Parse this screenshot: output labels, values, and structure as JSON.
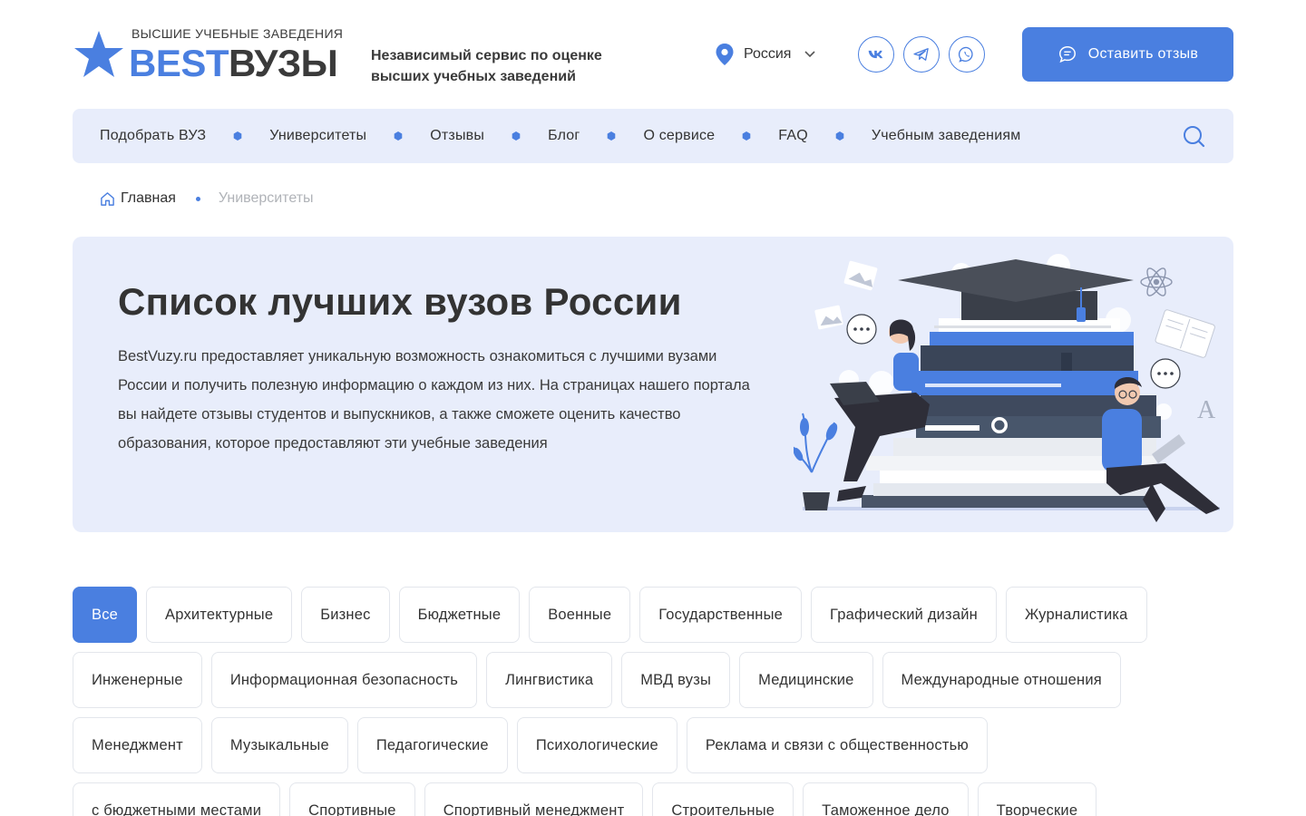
{
  "header": {
    "logo_small": "ВЫСШИЕ УЧЕБНЫЕ ЗАВЕДЕНИЯ",
    "logo_best": "BEST",
    "logo_vuzy": "ВУЗЫ",
    "tagline_line1": "Независимый сервис по оценке",
    "tagline_line2": "высших учебных заведений",
    "region": "Россия",
    "review_button": "Оставить отзыв",
    "socials": [
      "vk-icon",
      "telegram-icon",
      "whatsapp-icon"
    ]
  },
  "nav": {
    "items": [
      "Подобрать ВУЗ",
      "Университеты",
      "Отзывы",
      "Блог",
      "О сервисе",
      "FAQ",
      "Учебным заведениям"
    ]
  },
  "breadcrumb": {
    "home": "Главная",
    "current": "Университеты"
  },
  "hero": {
    "title": "Список лучших вузов России",
    "text": "BestVuzy.ru предоставляет уникальную возможность ознакомиться с лучшими вузами России и получить полезную информацию о каждом из них. На страницах нашего портала вы найдете отзывы студентов и выпускников, а также сможете оценить качество образования, которое предоставляют эти учебные заведения"
  },
  "filters": {
    "active": "Все",
    "rows": [
      [
        "Все",
        "Архитектурные",
        "Бизнес",
        "Бюджетные",
        "Военные",
        "Государственные",
        "Графический дизайн",
        "Журналистика"
      ],
      [
        "Инженерные",
        "Информационная безопасность",
        "Лингвистика",
        "МВД вузы",
        "Медицинские",
        "Международные отношения"
      ],
      [
        "Менеджмент",
        "Музыкальные",
        "Педагогические",
        "Психологические",
        "Реклама и связи с общественностью"
      ],
      [
        "с бюджетными местами",
        "Спортивные",
        "Спортивный менеджмент",
        "Строительные",
        "Таможенное дело",
        "Творческие"
      ]
    ]
  },
  "colors": {
    "accent": "#4a7fe0",
    "light_bg": "#e8edfb",
    "text": "#333333",
    "muted": "#b0b3b8"
  }
}
